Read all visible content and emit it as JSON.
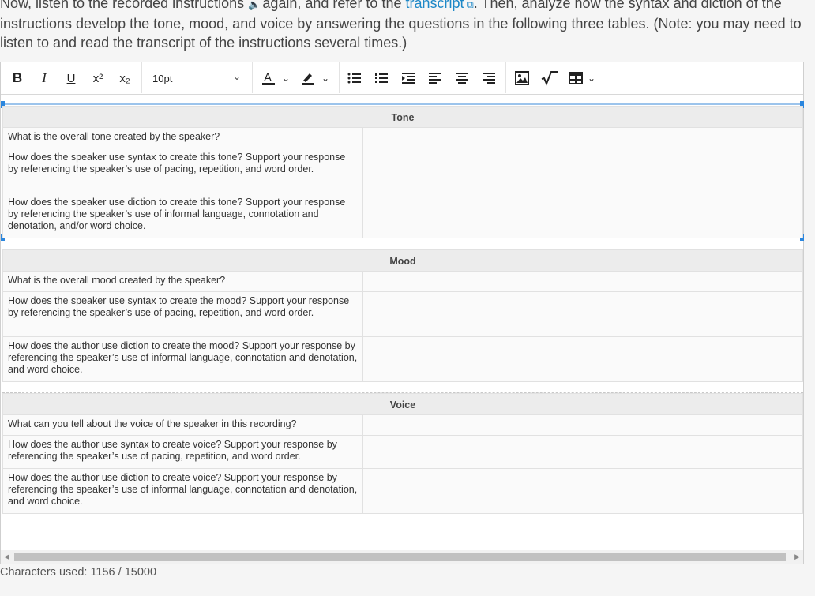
{
  "instructions": {
    "part1": "Now, listen to the recorded instructions ",
    "audio_icon": "speaker-icon",
    "part2": "again, and refer to the ",
    "link_text": "transcript",
    "link_icon": "external-link-icon",
    "part3": ". Then, analyze how the syntax and diction of the instructions develop the tone, mood, and voice by answering the questions in the following three tables. (Note: you may need to listen to and read the transcript of the instructions several times.)"
  },
  "toolbar": {
    "bold": "B",
    "italic": "I",
    "underline": "U",
    "superscript": "x²",
    "subscript": "x₂",
    "font_size": "10pt",
    "icons": [
      "bold-icon",
      "italic-icon",
      "underline-icon",
      "superscript-icon",
      "subscript-icon",
      "font-color-icon",
      "highlight-icon",
      "bullet-list-icon",
      "numbered-list-icon",
      "indent-icon",
      "align-left-icon",
      "align-center-icon",
      "align-right-icon",
      "image-icon",
      "equation-icon",
      "table-icon"
    ]
  },
  "tables": [
    {
      "heading": "Tone",
      "rows": [
        {
          "question": "What is the overall tone created by the speaker?",
          "answer": ""
        },
        {
          "question": "How does the speaker use syntax to create this tone? Support your response by referencing the speaker’s use of pacing, repetition, and word order.",
          "answer": ""
        },
        {
          "question": "How does the speaker use diction to create this tone? Support your response by referencing the speaker’s use of informal language, connotation and denotation, and/or word choice.",
          "answer": ""
        }
      ]
    },
    {
      "heading": "Mood",
      "rows": [
        {
          "question": "What is the overall mood created by the speaker?",
          "answer": ""
        },
        {
          "question": "How does the speaker use syntax to create the mood? Support your response by referencing the speaker’s use of pacing, repetition, and word order.",
          "answer": ""
        },
        {
          "question": "How does the author use diction to create the mood? Support your response by referencing the speaker’s use of informal language, connotation and denotation, and word choice.",
          "answer": ""
        }
      ]
    },
    {
      "heading": "Voice",
      "rows": [
        {
          "question": "What can you tell about the voice of the speaker in this recording?",
          "answer": ""
        },
        {
          "question": "How does the author use syntax to create voice? Support your response by referencing the speaker’s use of pacing, repetition, and word order.",
          "answer": ""
        },
        {
          "question": "How does the author use diction to create voice? Support your response by referencing the speaker’s use of informal language, connotation and denotation, and word choice.",
          "answer": ""
        }
      ]
    }
  ],
  "footer": {
    "characters_used": "Characters used: 1156 / 15000"
  }
}
